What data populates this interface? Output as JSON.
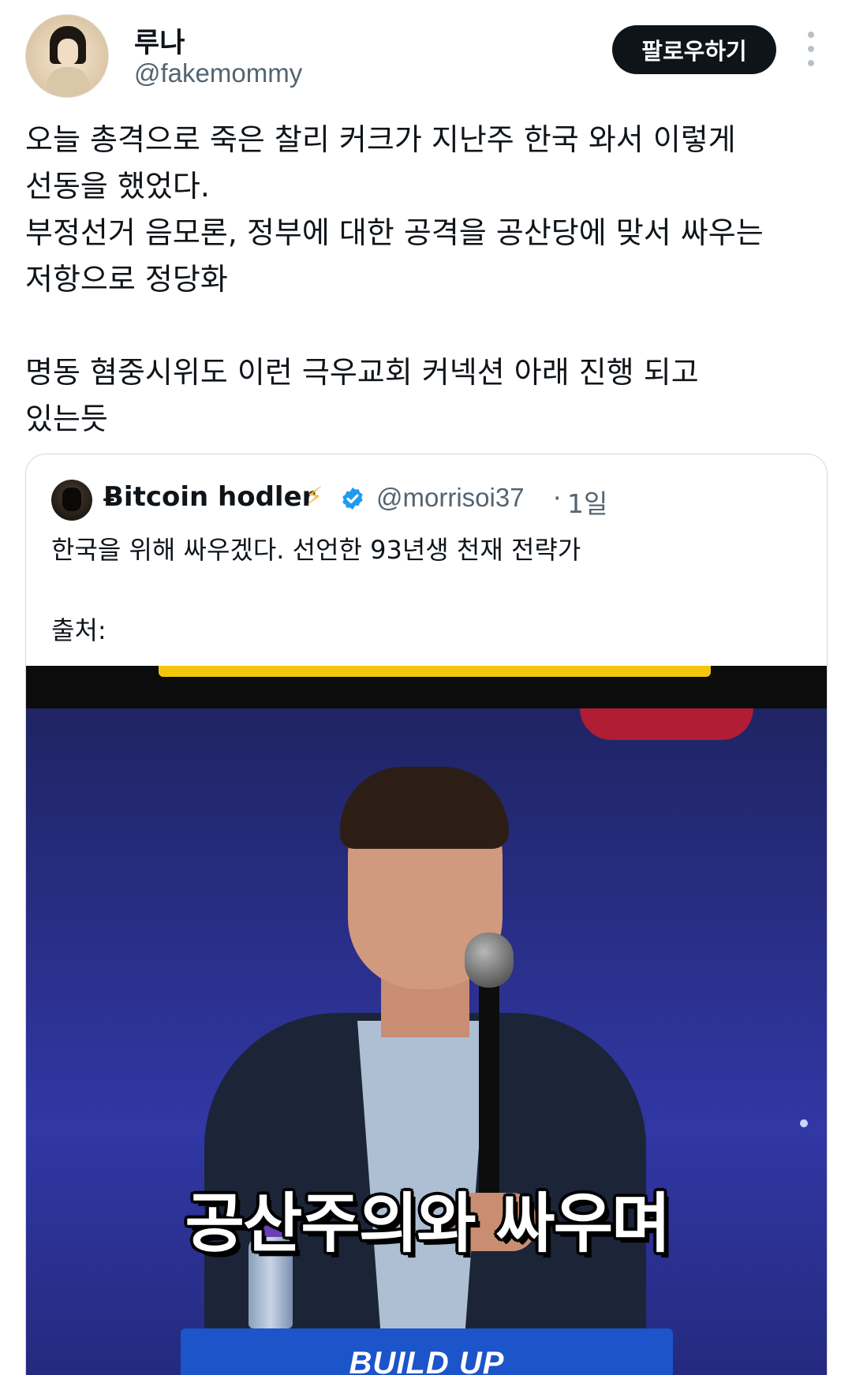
{
  "author": {
    "display_name": "루나",
    "handle": "@fakemommy",
    "follow_label": "팔로우하기"
  },
  "tweet": {
    "text": "오늘 총격으로 죽은 찰리 커크가 지난주 한국 와서 이렇게\n선동을 했었다.\n부정선거 음모론, 정부에 대한 공격을 공산당에 맞서 싸우는\n저항으로 정당화\n\n명동 혐중시위도 이런 극우교회 커넥션 아래 진행 되고\n있는듯"
  },
  "quoted_tweet": {
    "display_name": "Ƀitcoin hodler",
    "name_emoji": "⚡",
    "handle": "@morrisoi37",
    "separator": "·",
    "time": "1일",
    "text": "한국을 위해 싸우겠다. 선언한 93년생 천재 전략가\n\n출처:",
    "media": {
      "caption": "공산주의와 싸우며",
      "podium_text": "BUILD UP"
    }
  },
  "colors": {
    "text_primary": "#0f1419",
    "text_secondary": "#536471",
    "follow_bg": "#0f1419",
    "verified_blue": "#1d9bf0",
    "border": "#cfd9de"
  },
  "icons": {
    "more": "more-vertical-icon",
    "verified": "verified-badge-icon",
    "emoji": "lightning-icon"
  }
}
